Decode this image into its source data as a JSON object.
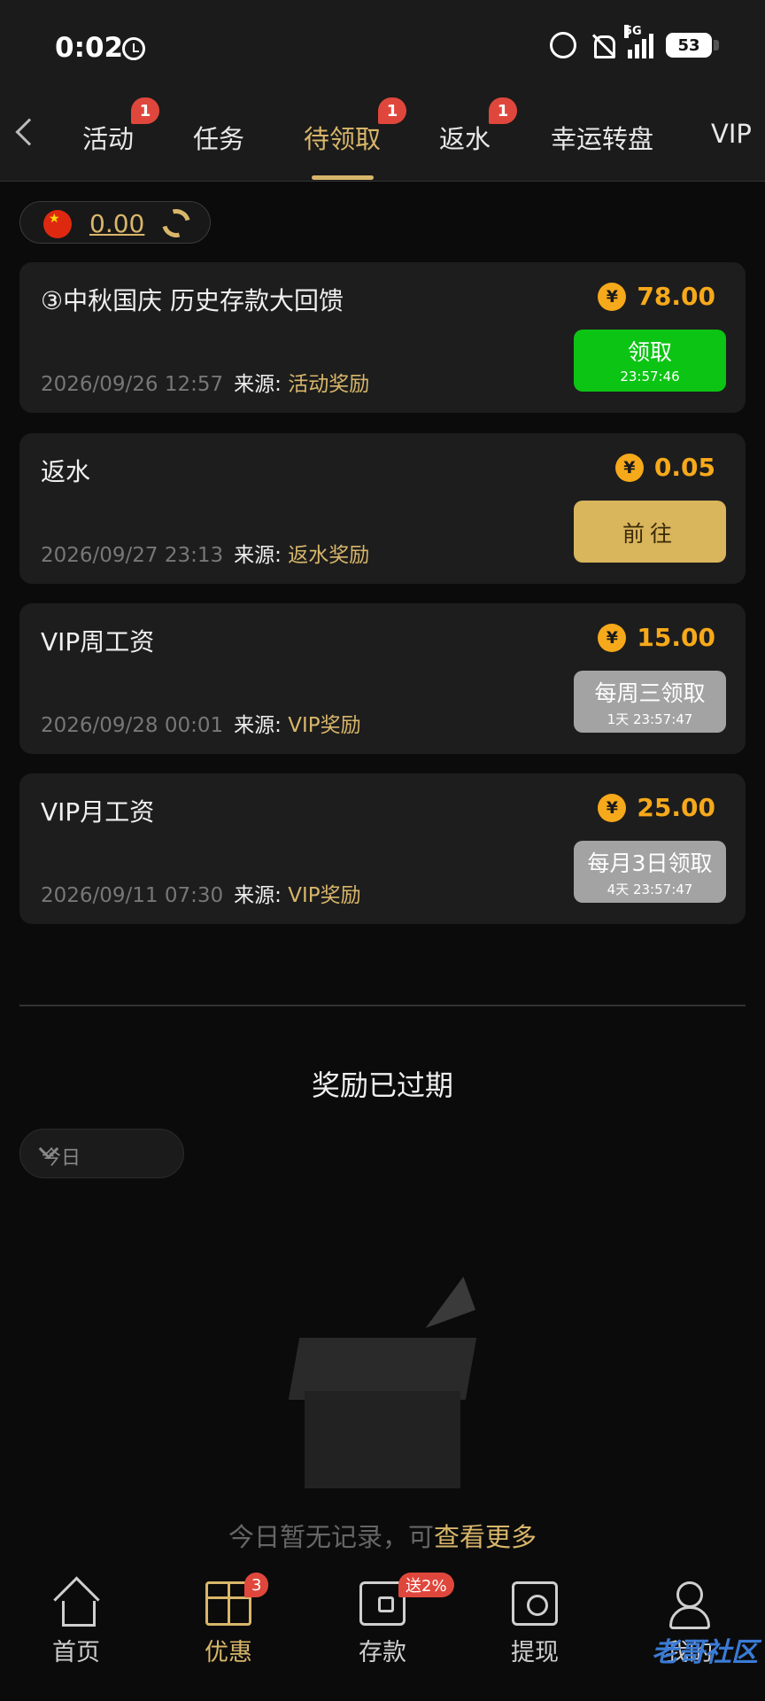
{
  "status": {
    "time": "0:02",
    "network": "5G",
    "battery": "53"
  },
  "tabs": [
    {
      "label": "活动",
      "badge": "1"
    },
    {
      "label": "任务",
      "badge": ""
    },
    {
      "label": "待领取",
      "badge": "1"
    },
    {
      "label": "返水",
      "badge": "1"
    },
    {
      "label": "幸运转盘",
      "badge": ""
    },
    {
      "label": "VIP",
      "badge": ""
    }
  ],
  "balance": {
    "amount": "0.00"
  },
  "cards": [
    {
      "title": "③中秋国庆 历史存款大回馈",
      "amount": "78.00",
      "date": "2026/09/26 12:57",
      "source_label": "来源:",
      "source": "活动奖励",
      "button": "领取",
      "button_sub": "23:57:46"
    },
    {
      "title": "返水",
      "amount": "0.05",
      "date": "2026/09/27 23:13",
      "source_label": "来源:",
      "source": "返水奖励",
      "button": "前往",
      "button_sub": ""
    },
    {
      "title": "VIP周工资",
      "amount": "15.00",
      "date": "2026/09/28 00:01",
      "source_label": "来源:",
      "source": "VIP奖励",
      "button": "每周三领取",
      "button_sub": "1天 23:57:47"
    },
    {
      "title": "VIP月工资",
      "amount": "25.00",
      "date": "2026/09/11 07:30",
      "source_label": "来源:",
      "source": "VIP奖励",
      "button": "每月3日领取",
      "button_sub": "4天 23:57:47"
    }
  ],
  "currency_symbol": "¥",
  "expired": {
    "title": "奖励已过期",
    "period": "今日",
    "empty_text": "今日暂无记录，可",
    "empty_link": "查看更多"
  },
  "nav": [
    {
      "label": "首页",
      "badge": ""
    },
    {
      "label": "优惠",
      "badge": "3"
    },
    {
      "label": "存款",
      "badge": "送2%"
    },
    {
      "label": "提现",
      "badge": ""
    },
    {
      "label": "我的",
      "badge": ""
    }
  ],
  "watermark": "老哥社区",
  "colors": {
    "accent": "#d8b66a",
    "amount": "#f6a91a",
    "claim": "#0cc414",
    "badge": "#e0473c"
  }
}
